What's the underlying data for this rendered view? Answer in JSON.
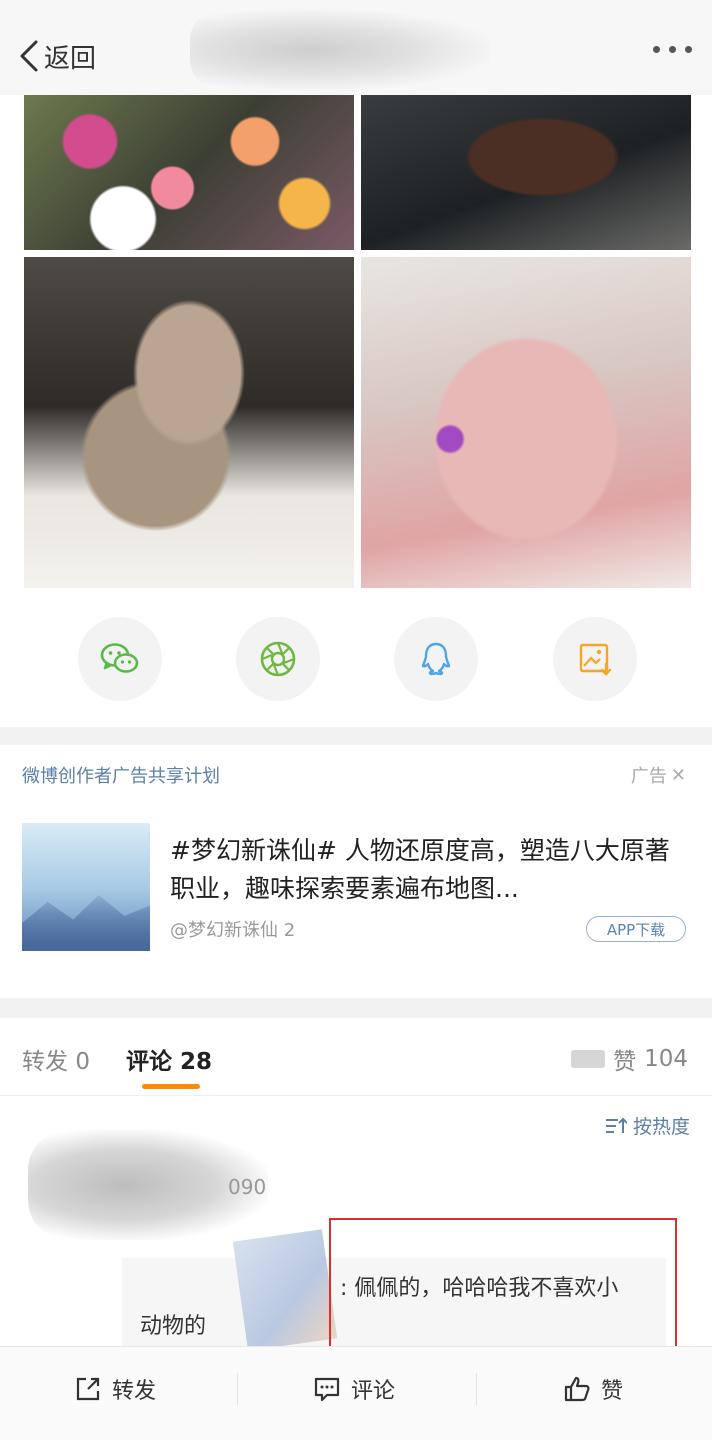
{
  "topbar": {
    "back_label": "返回"
  },
  "share": {
    "items": [
      "wechat-icon",
      "moments-icon",
      "qq-icon",
      "save-image-icon"
    ],
    "colors": {
      "wechat": "#5bb94a",
      "moments": "#6fb83f",
      "qq": "#4aa6e8",
      "save": "#f5a623"
    }
  },
  "ad": {
    "header": "微博创作者广告共享计划",
    "tag": "广告",
    "title": "#梦幻新诛仙# 人物还原度高，塑造八大原著职业，趣味探索要素遍布地图...",
    "source": "@梦幻新诛仙 2",
    "button": "APP下载"
  },
  "tabs": {
    "repost_label": "转发",
    "repost_count": "0",
    "comment_label": "评论",
    "comment_count": "28",
    "like_label": "赞",
    "like_count": "104",
    "accent": "#ff8a00"
  },
  "sort": {
    "label": "按热度"
  },
  "comment": {
    "number_fragment": "090",
    "reply_line1": ": 佩佩的，哈哈哈我不喜欢小",
    "reply_line2": "动物的"
  },
  "bottombar": {
    "repost": "转发",
    "comment": "评论",
    "like": "赞"
  }
}
